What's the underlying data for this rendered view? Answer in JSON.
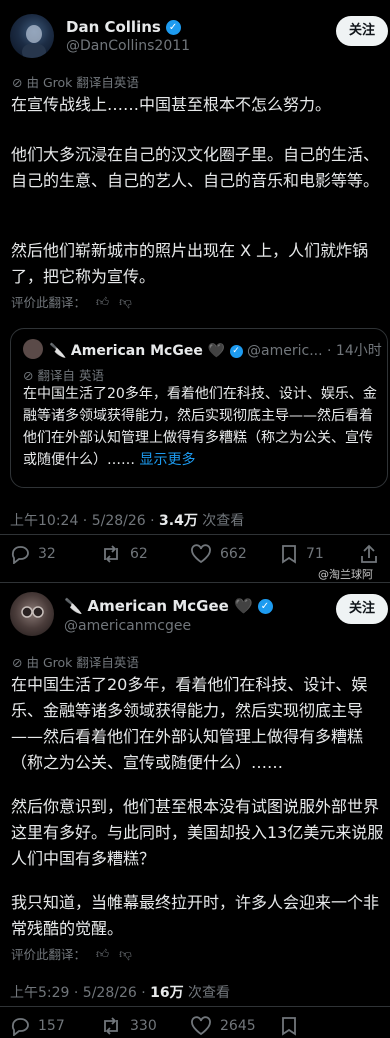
{
  "post1": {
    "author_name": "Dan Collins",
    "author_handle": "@DanCollins2011",
    "follow_label": "关注",
    "translate_label": "由 Grok 翻译自英语",
    "text_p1": "在宣传战线上……中国甚至根本不怎么努力。",
    "text_p2": "他们大多沉浸在自己的汉文化圈子里。自己的生活、自己的生意、自己的艺人、自己的音乐和电影等等。",
    "text_p3": "然后他们崭新城市的照片出现在 X 上，人们就炸锅了，把它称为宣传。",
    "rate_translation": "评价此翻译：",
    "quote": {
      "author_name": "American McGee 🖤",
      "author_handle": "@americ...",
      "time": "· 14小时",
      "translate_label": "翻译自 英语",
      "text": "在中国生活了20多年，看着他们在科技、设计、娱乐、金融等诸多领域获得能力，然后实现彻底主导——然后看着他们在外部认知管理上做得有多糟糕（称之为公关、宣传或随便什么）……",
      "show_more": "显示更多"
    },
    "time": "上午10:24 · 5/28/26 · ",
    "views": "3.4万",
    "views_suffix": " 次查看",
    "replies": "32",
    "reposts": "62",
    "likes": "662",
    "bookmarks": "71"
  },
  "watermark": "@淘兰球阿",
  "post2": {
    "author_name": "American McGee 🖤",
    "author_handle": "@americanmcgee",
    "follow_label": "关注",
    "translate_label": "由 Grok 翻译自英语",
    "text_p1": "在中国生活了20多年，看着他们在科技、设计、娱乐、金融等诸多领域获得能力，然后实现彻底主导——然后看着他们在外部认知管理上做得有多糟糕（称之为公关、宣传或随便什么）……",
    "text_p2": "然后你意识到，他们甚至根本没有试图说服外部世界这里有多好。与此同时，美国却投入13亿美元来说服人们中国有多糟糕？",
    "text_p3": "我只知道，当帷幕最终拉开时，许多人会迎来一个非常残酷的觉醒。",
    "rate_translation": "评价此翻译：",
    "time": "上午5:29 · 5/28/26 · ",
    "views": "16万",
    "views_suffix": " 次查看",
    "replies": "157",
    "reposts": "330",
    "likes": "2645"
  },
  "colors": {
    "accent": "#1d9bf0",
    "bg": "#000000",
    "text": "#e7e9ea",
    "muted": "#71767b"
  }
}
